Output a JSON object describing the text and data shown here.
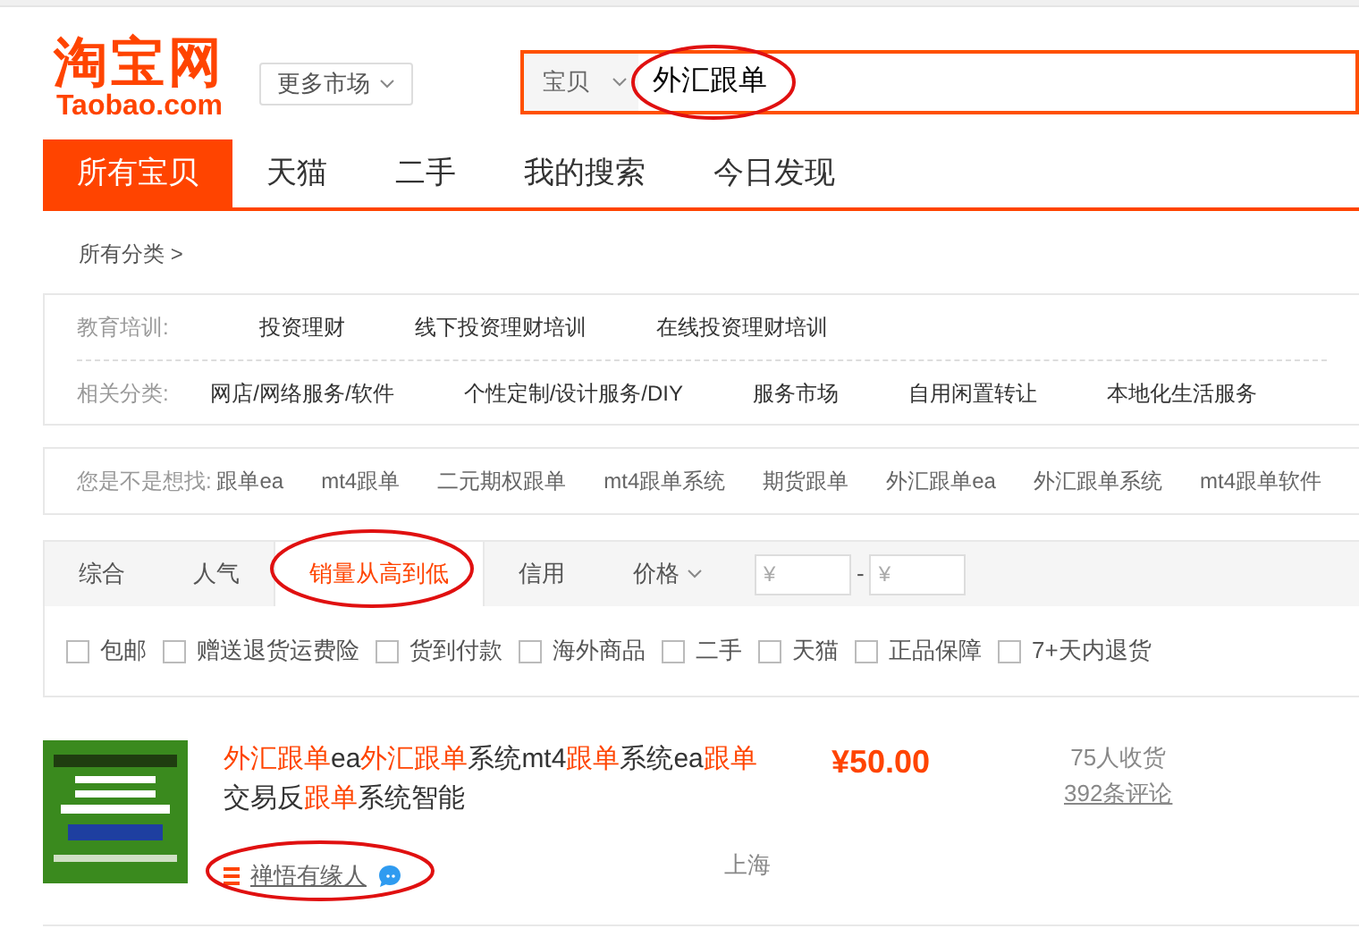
{
  "logo": {
    "mark": "淘宝网",
    "domain": "Taobao.com"
  },
  "market_button": {
    "label": "更多市场"
  },
  "search": {
    "scope": "宝贝",
    "value": "外汇跟单",
    "circled": true
  },
  "nav_tabs": [
    {
      "label": "所有宝贝",
      "selected": true
    },
    {
      "label": "天猫",
      "selected": false
    },
    {
      "label": "二手",
      "selected": false
    },
    {
      "label": "我的搜索",
      "selected": false
    },
    {
      "label": "今日发现",
      "selected": false
    }
  ],
  "breadcrumb": "所有分类 >",
  "categories": [
    {
      "label": "教育培训:",
      "items": [
        "投资理财",
        "线下投资理财培训",
        "在线投资理财培训"
      ]
    },
    {
      "label": "相关分类:",
      "items": [
        "网店/网络服务/软件",
        "个性定制/设计服务/DIY",
        "服务市场",
        "自用闲置转让",
        "本地化生活服务"
      ]
    }
  ],
  "suggestions": {
    "label": "您是不是想找:",
    "items": [
      "跟单ea",
      "mt4跟单",
      "二元期权跟单",
      "mt4跟单系统",
      "期货跟单",
      "外汇跟单ea",
      "外汇跟单系统",
      "mt4跟单软件"
    ]
  },
  "sort_options": [
    {
      "label": "综合",
      "selected": false,
      "kind": "plain"
    },
    {
      "label": "人气",
      "selected": false,
      "kind": "plain"
    },
    {
      "label": "销量从高到低",
      "selected": true,
      "kind": "plain",
      "circled": true
    },
    {
      "label": "信用",
      "selected": false,
      "kind": "plain"
    },
    {
      "label": "价格",
      "selected": false,
      "kind": "dropdown"
    }
  ],
  "price_range": {
    "min_placeholder": "¥",
    "separator": "-",
    "max_placeholder": "¥"
  },
  "filters": [
    {
      "label": "包邮",
      "checked": false
    },
    {
      "label": "赠送退货运费险",
      "checked": false
    },
    {
      "label": "货到付款",
      "checked": false
    },
    {
      "label": "海外商品",
      "checked": false
    },
    {
      "label": "二手",
      "checked": false
    },
    {
      "label": "天猫",
      "checked": false
    },
    {
      "label": "正品保障",
      "checked": false
    },
    {
      "label": "7+天内退货",
      "checked": false
    }
  ],
  "products": [
    {
      "title": [
        {
          "text": "外汇跟单",
          "highlight": true
        },
        {
          "text": "ea",
          "highlight": false
        },
        {
          "text": "外汇跟单",
          "highlight": true
        },
        {
          "text": "系统mt4",
          "highlight": false
        },
        {
          "text": "跟单",
          "highlight": true
        },
        {
          "text": "系统ea",
          "highlight": false
        },
        {
          "text": "跟单",
          "highlight": true
        },
        {
          "text": "交易反",
          "highlight": false
        },
        {
          "text": "跟单",
          "highlight": true
        },
        {
          "text": "系统智能",
          "highlight": false
        }
      ],
      "price": "¥50.00",
      "sales": "75人收货",
      "reviews": "392条评论",
      "seller": "禅悟有缘人",
      "seller_circled": true,
      "location": "上海"
    }
  ]
}
